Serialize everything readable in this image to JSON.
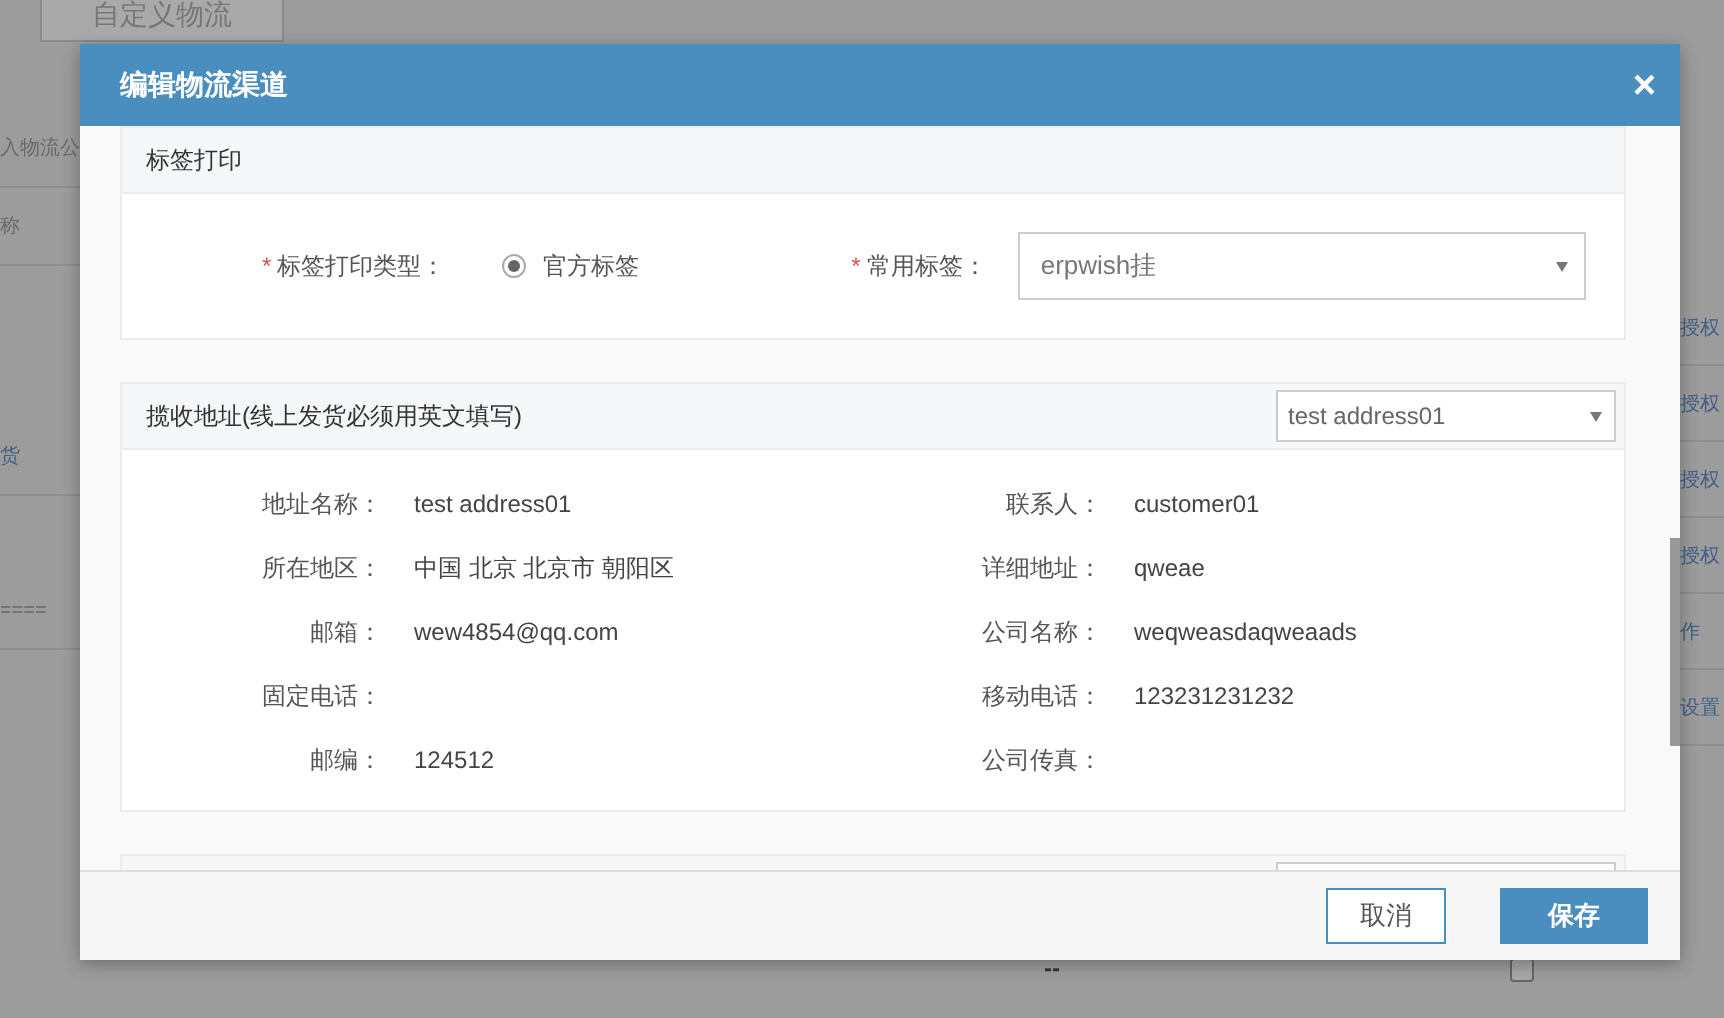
{
  "background": {
    "tab": "自定义物流",
    "left_texts": [
      "入物流公",
      "称",
      "货",
      "===="
    ],
    "right_texts": [
      "授权",
      "授权",
      "授权",
      "授权",
      "作",
      "设置"
    ],
    "bottom_text": "--",
    "checkbox_checked": false
  },
  "dialog": {
    "title": "编辑物流渠道",
    "close": "×",
    "label_section": {
      "title": "标签打印",
      "required_mark": "*",
      "type_label": "标签打印类型：",
      "options": [
        {
          "label": "官方标签",
          "selected": true
        }
      ],
      "common_label": "常用标签：",
      "common_value": "erpwish挂"
    },
    "address_section": {
      "title": "揽收地址(线上发货必须用英文填写)",
      "select_value": "test address01",
      "fields": [
        {
          "label": "地址名称：",
          "value": "test address01"
        },
        {
          "label": "联系人：",
          "value": "customer01"
        },
        {
          "label": "所在地区：",
          "value": "中国 北京 北京市 朝阳区"
        },
        {
          "label": "详细地址：",
          "value": "qweae"
        },
        {
          "label": "邮箱：",
          "value": "wew4854@qq.com"
        },
        {
          "label": "公司名称：",
          "value": "weqweasdaqweaads"
        },
        {
          "label": "固定电话："
        },
        {
          "label": "移动电话：",
          "value": "123231231232"
        },
        {
          "label": "邮编：",
          "value": "124512"
        },
        {
          "label": "公司传真："
        }
      ]
    },
    "buttons": [
      {
        "label": "取消",
        "kind": "secondary"
      },
      {
        "label": "保存",
        "kind": "primary"
      }
    ]
  }
}
